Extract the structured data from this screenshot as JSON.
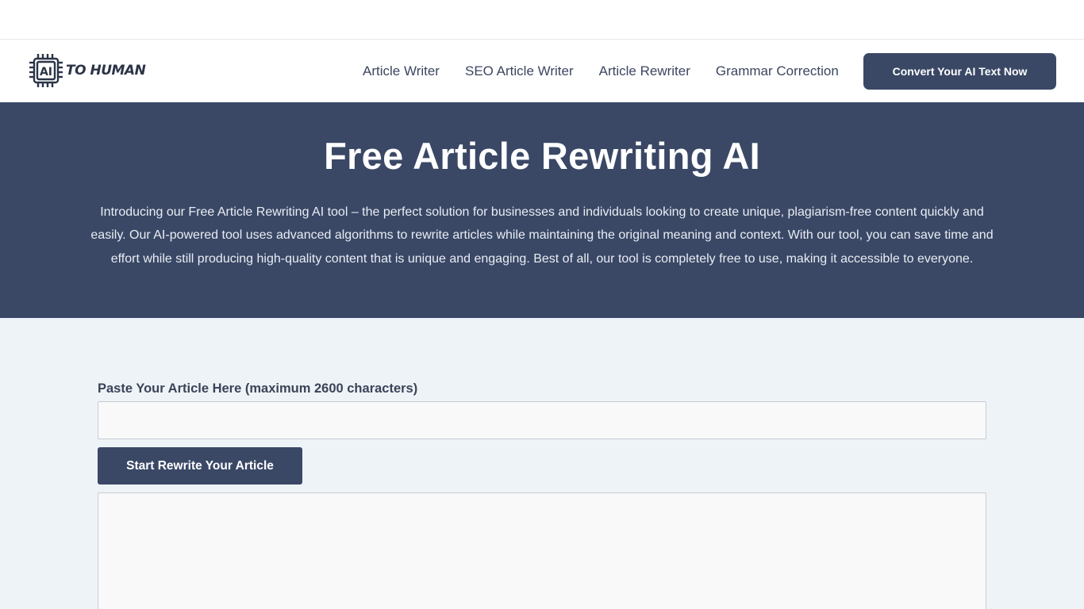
{
  "brand": {
    "logo_text": "TO HUMAN",
    "logo_chip_text": "AI",
    "icon": "cpu-chip-icon",
    "color": "#2b3447"
  },
  "nav": {
    "items": [
      {
        "label": "Article Writer"
      },
      {
        "label": "SEO Article Writer"
      },
      {
        "label": "Article Rewriter"
      },
      {
        "label": "Grammar Correction"
      }
    ],
    "cta_label": "Convert Your AI Text Now"
  },
  "hero": {
    "title": "Free Article Rewriting AI",
    "description": "Introducing our Free Article Rewriting AI tool – the perfect solution for businesses and individuals looking to create unique, plagiarism-free content quickly and easily. Our AI-powered tool uses advanced algorithms to rewrite articles while maintaining the original meaning and context. With our tool, you can save time and effort while still producing high-quality content that is unique and engaging. Best of all, our tool is completely free to use, making it accessible to everyone."
  },
  "form": {
    "input_label": "Paste Your Article Here (maximum 2600 characters)",
    "input_value": "",
    "submit_label": "Start Rewrite Your Article",
    "output_value": ""
  },
  "colors": {
    "accent": "#3a4866",
    "page_bg": "#eef3f7",
    "field_bg": "#f9f9f9"
  }
}
